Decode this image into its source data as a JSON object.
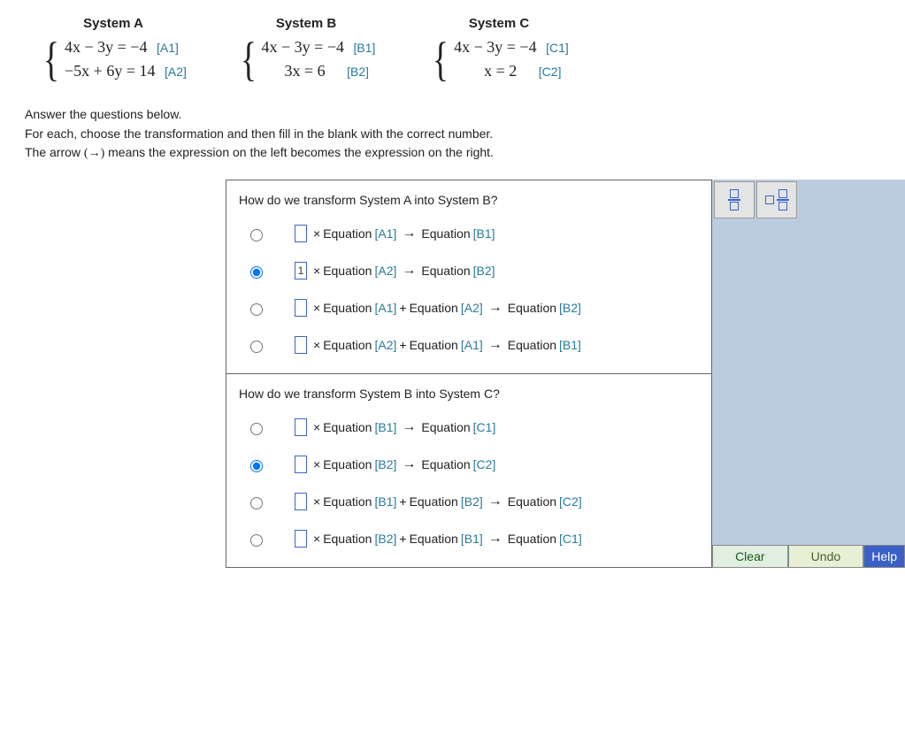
{
  "systems": {
    "A": {
      "title": "System A",
      "eq1": "4x − 3y = −4",
      "tag1": "[A1]",
      "eq2": "−5x + 6y = 14",
      "tag2": "[A2]"
    },
    "B": {
      "title": "System B",
      "eq1": "4x − 3y = −4",
      "tag1": "[B1]",
      "eq2": "3x = 6",
      "tag2": "[B2]"
    },
    "C": {
      "title": "System C",
      "eq1": "4x − 3y = −4",
      "tag1": "[C1]",
      "eq2": "x = 2",
      "tag2": "[C2]"
    }
  },
  "instructions": {
    "line1": "Answer the questions below.",
    "line2": "For each, choose the transformation and then fill in the blank with the correct number.",
    "line3_pre": "The arrow ",
    "line3_sym": "(→)",
    "line3_post": " means the expression on the left becomes the expression on the right."
  },
  "labels": {
    "equation": "Equation",
    "times": "×",
    "plus": "+",
    "arrow": "→"
  },
  "questions": [
    {
      "title": "How do we transform System A into System B?",
      "options": [
        {
          "selected": false,
          "value": "",
          "parts": [
            "[A1]"
          ],
          "result": "[B1]"
        },
        {
          "selected": true,
          "value": "1",
          "parts": [
            "[A2]"
          ],
          "result": "[B2]"
        },
        {
          "selected": false,
          "value": "",
          "parts": [
            "[A1]",
            "[A2]"
          ],
          "result": "[B2]"
        },
        {
          "selected": false,
          "value": "",
          "parts": [
            "[A2]",
            "[A1]"
          ],
          "result": "[B1]"
        }
      ]
    },
    {
      "title": "How do we transform System B into System C?",
      "options": [
        {
          "selected": false,
          "value": "",
          "parts": [
            "[B1]"
          ],
          "result": "[C1]"
        },
        {
          "selected": true,
          "value": "",
          "parts": [
            "[B2]"
          ],
          "result": "[C2]"
        },
        {
          "selected": false,
          "value": "",
          "parts": [
            "[B1]",
            "[B2]"
          ],
          "result": "[C2]"
        },
        {
          "selected": false,
          "value": "",
          "parts": [
            "[B2]",
            "[B1]"
          ],
          "result": "[C1]"
        }
      ]
    }
  ],
  "buttons": {
    "clear": "Clear",
    "undo": "Undo",
    "help": "Help"
  }
}
